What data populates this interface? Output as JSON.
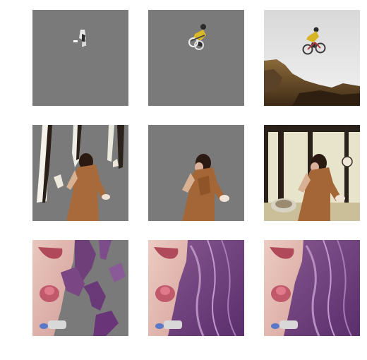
{
  "grid": {
    "rows": [
      {
        "name": "bmx-rider",
        "panels": [
          "masked-partial",
          "masked-subject",
          "original"
        ]
      },
      {
        "name": "woman-at-window",
        "panels": [
          "masked-partial",
          "masked-subject",
          "original"
        ]
      },
      {
        "name": "purple-hair-closeup",
        "panels": [
          "masked-partial",
          "masked-subject",
          "original"
        ]
      }
    ],
    "mask_color": "#7a7a7a"
  }
}
